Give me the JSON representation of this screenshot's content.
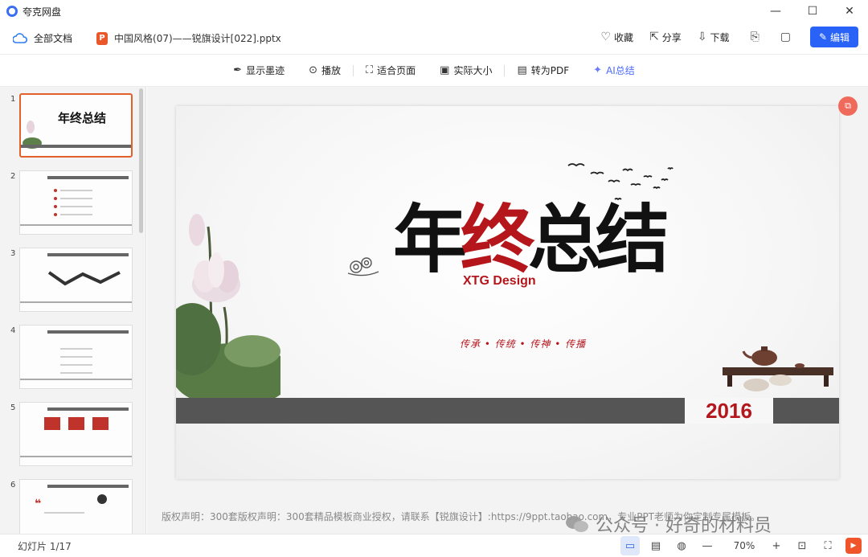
{
  "app": {
    "title": "夸克网盘"
  },
  "window": {
    "minimize": "—",
    "maximize": "☐",
    "close": "✕"
  },
  "header": {
    "all_docs": "全部文档",
    "file_icon_letter": "P",
    "file_name": "中国风格(07)——锐旗设计[022].pptx",
    "favorite": "收藏",
    "share": "分享",
    "download": "下载",
    "edit": "编辑"
  },
  "toolbar": {
    "show_ink": "显示墨迹",
    "play": "播放",
    "fit_page": "适合页面",
    "actual_size": "实际大小",
    "to_pdf": "转为PDF",
    "ai_summary": "AI总结"
  },
  "sidebar": {
    "thumbnails": [
      {
        "number": "1",
        "title": "年终总结"
      },
      {
        "number": "2"
      },
      {
        "number": "3"
      },
      {
        "number": "4"
      },
      {
        "number": "5"
      },
      {
        "number": "6"
      }
    ]
  },
  "slide": {
    "title_chars": [
      "年",
      "终",
      "总",
      "结"
    ],
    "subtitle": "XTG Design",
    "slogan": "传承 • 传统 • 传神 • 传播",
    "year": "2016"
  },
  "canvas": {
    "copyright": "版权声明：300套版权声明：300套精品模板商业授权，请联系【锐旗设计】:https://9ppt.taobao.com，专业PPT老师为你定制专属模板。",
    "watermark": "公众号 · 好奇的材料员"
  },
  "statusbar": {
    "slide_count": "幻灯片 1/17",
    "zoom_minus": "—",
    "zoom": "70%",
    "zoom_plus": "+"
  },
  "colors": {
    "accent": "#2862f6",
    "brand_red": "#b4161c",
    "active_thumb": "#e2602b"
  }
}
